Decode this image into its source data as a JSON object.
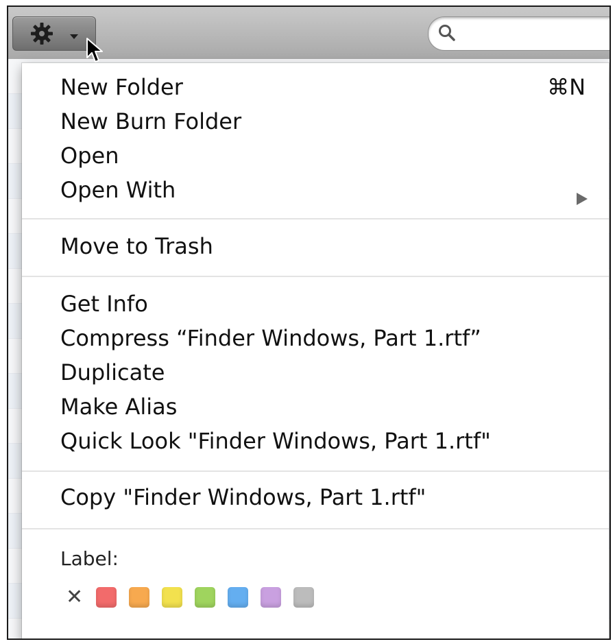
{
  "toolbar": {
    "action_button_icon": "gear-icon",
    "dropdown_icon": "chevron-down-icon",
    "search": {
      "value": "",
      "icon": "search-icon"
    }
  },
  "menu": {
    "items": [
      {
        "label": "New Folder",
        "shortcut": "⌘N"
      },
      {
        "label": "New Burn Folder"
      },
      {
        "label": "Open"
      },
      {
        "label": "Open With",
        "submenu_icon": "submenu-arrow-icon"
      },
      {
        "label": "Move to Trash"
      },
      {
        "label": "Get Info"
      },
      {
        "label": "Compress “Finder Windows, Part 1.rtf”"
      },
      {
        "label": "Duplicate"
      },
      {
        "label": "Make Alias"
      },
      {
        "label": "Quick Look \"Finder Windows, Part 1.rtf\""
      },
      {
        "label": "Copy \"Finder Windows, Part 1.rtf\""
      }
    ],
    "label_section": {
      "title": "Label:",
      "clear_symbol": "✕",
      "colors": [
        "#f26b6b",
        "#f7a94f",
        "#f2e14e",
        "#9fd45e",
        "#64aef0",
        "#c9a0e0",
        "#bcbcbc"
      ]
    }
  }
}
